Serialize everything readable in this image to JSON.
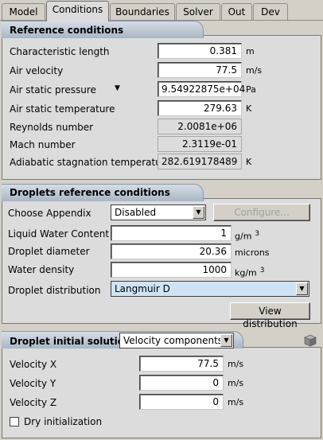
{
  "tabs": [
    "Model",
    "Conditions",
    "Boundaries",
    "Solver",
    "Out",
    "Dev"
  ],
  "reference": {
    "title": "Reference conditions",
    "rows": [
      {
        "label": "Characteristic length",
        "value": "0.381",
        "unit": "m"
      },
      {
        "label": "Air velocity",
        "value": "77.5",
        "unit": "m/s"
      },
      {
        "label": "Air static pressure",
        "value": "9.54922875e+04",
        "unit": "Pa"
      },
      {
        "label": "Air static temperature",
        "value": "279.63",
        "unit": "K"
      },
      {
        "label": "Reynolds number",
        "value": "2.0081e+06",
        "unit": ""
      },
      {
        "label": "Mach number",
        "value": "2.3119e-01",
        "unit": ""
      },
      {
        "label": "Adiabatic stagnation temperature",
        "value": "282.619178489",
        "unit": "K"
      }
    ],
    "pressure_marker": "▼"
  },
  "droplets": {
    "title": "Droplets reference conditions",
    "appendix_label": "Choose Appendix",
    "appendix_value": "Disabled",
    "configure_label": "Configure...",
    "lwc_label": "Liquid Water Content",
    "lwc_value": "1",
    "lwc_unit": "g/m",
    "lwc_unit_sup": "3",
    "diameter_label": "Droplet diameter",
    "diameter_value": "20.36",
    "diameter_unit": "microns",
    "density_label": "Water density",
    "density_value": "1000",
    "density_unit": "kg/m",
    "density_unit_sup": "3",
    "distribution_label": "Droplet distribution",
    "distribution_value": "Langmuir D",
    "view_label": "View distribution"
  },
  "initial": {
    "title": "Droplet initial solution",
    "mode_value": "Velocity components",
    "rows": [
      {
        "label": "Velocity X",
        "value": "77.5",
        "unit": "m/s"
      },
      {
        "label": "Velocity Y",
        "value": "0",
        "unit": "m/s"
      },
      {
        "label": "Velocity Z",
        "value": "0",
        "unit": "m/s"
      }
    ],
    "dry_label": "Dry initialization",
    "dry_checked": false
  }
}
